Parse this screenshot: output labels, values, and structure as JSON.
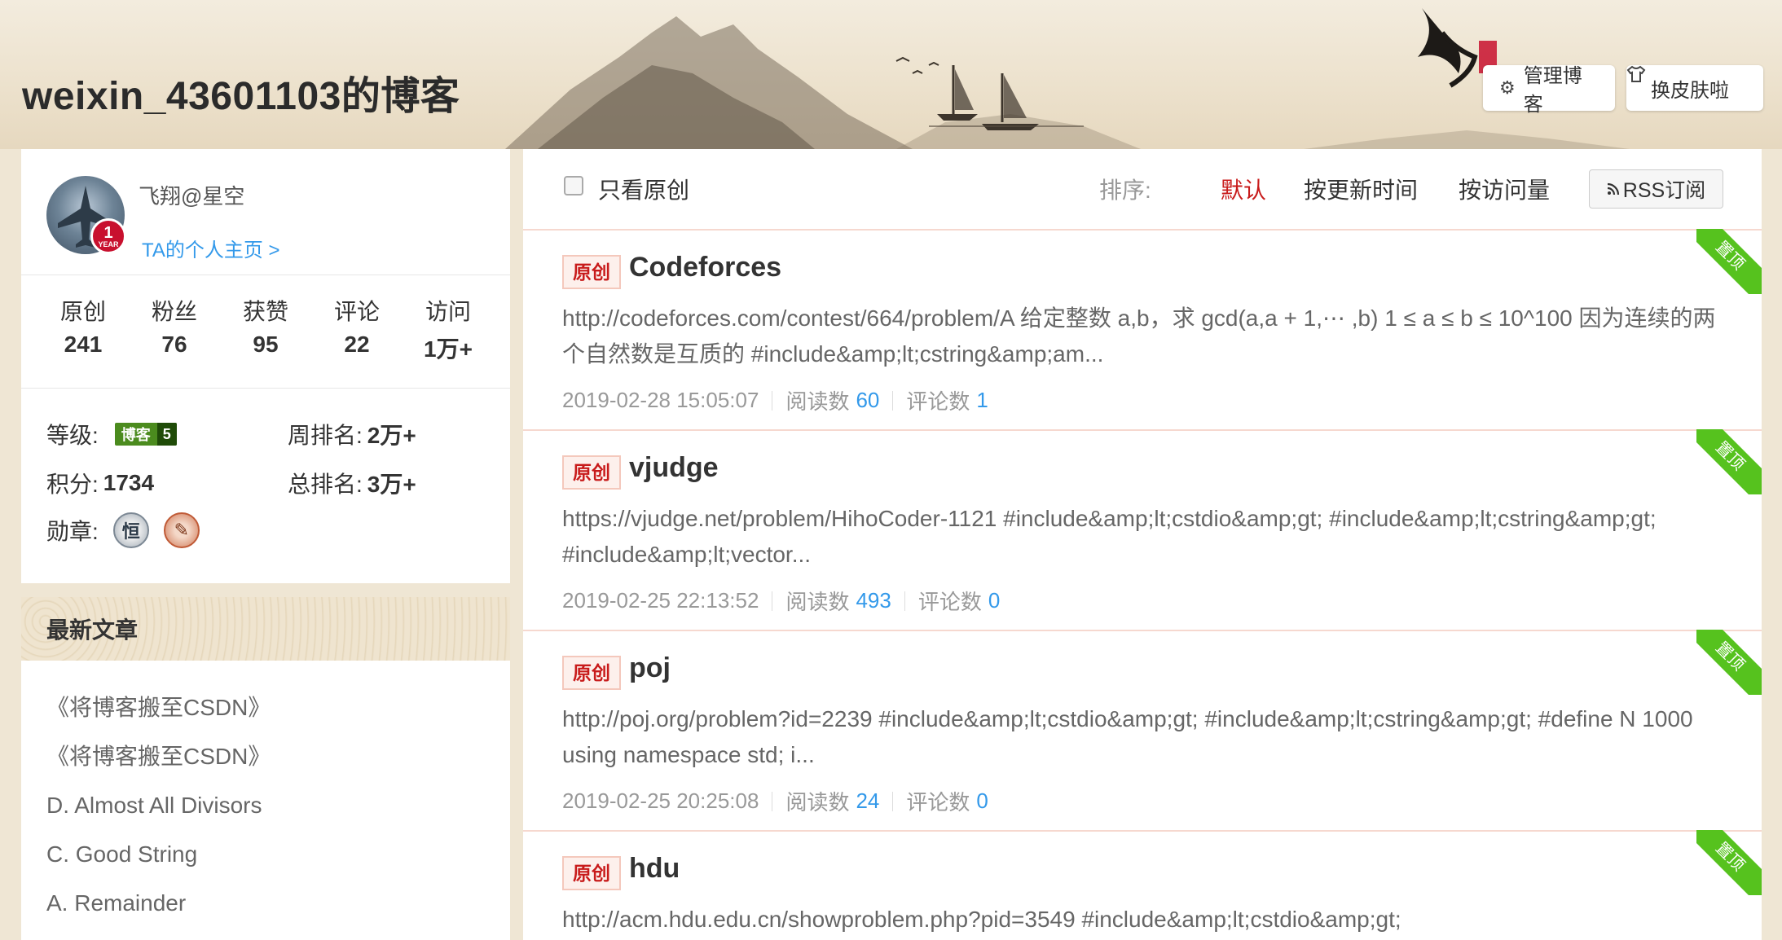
{
  "header": {
    "blog_title": "weixin_43601103的博客",
    "manage_label": "管理博客",
    "skin_label": "换皮肤啦"
  },
  "profile": {
    "name": "飞翔@星空",
    "home_link": "TA的个人主页 >",
    "year_badge": "1",
    "year_text": "YEAR"
  },
  "stats": [
    {
      "label": "原创",
      "value": "241"
    },
    {
      "label": "粉丝",
      "value": "76"
    },
    {
      "label": "获赞",
      "value": "95"
    },
    {
      "label": "评论",
      "value": "22"
    },
    {
      "label": "访问",
      "value": "1万+"
    }
  ],
  "info": {
    "level_label": "等级:",
    "level_badge_text": "博客",
    "level_badge_num": "5",
    "points_label": "积分:",
    "points_value": "1734",
    "medals_label": "勋章:",
    "medal1_text": "恒",
    "week_rank_label": "周排名:",
    "week_rank_value": "2万+",
    "total_rank_label": "总排名:",
    "total_rank_value": "3万+"
  },
  "recent": {
    "heading": "最新文章",
    "items": [
      "《将博客搬至CSDN》",
      "《将博客搬至CSDN》",
      "D. Almost All Divisors",
      "C. Good String",
      "A. Remainder"
    ]
  },
  "filter": {
    "only_original": "只看原创",
    "sort_label": "排序:",
    "sort_default": "默认",
    "sort_update": "按更新时间",
    "sort_visit": "按访问量",
    "rss": "RSS订阅"
  },
  "articles": [
    {
      "tag": "原创",
      "title": "Codeforces",
      "summary": "http://codeforces.com/contest/664/problem/A 给定整数 a,b，求 gcd(a,a + 1,⋯ ,b) 1 ≤ a ≤ b ≤ 10^100 因为连续的两个自然数是互质的 #include&amp;lt;cstring&amp;am...",
      "date": "2019-02-28 15:05:07",
      "read_label": "阅读数",
      "read": "60",
      "comment_label": "评论数",
      "comment": "1",
      "pinned": "置顶"
    },
    {
      "tag": "原创",
      "title": "vjudge",
      "summary": "https://vjudge.net/problem/HihoCoder-1121 #include&amp;lt;cstdio&amp;gt; #include&amp;lt;cstring&amp;gt; #include&amp;lt;vector...",
      "date": "2019-02-25 22:13:52",
      "read_label": "阅读数",
      "read": "493",
      "comment_label": "评论数",
      "comment": "0",
      "pinned": "置顶"
    },
    {
      "tag": "原创",
      "title": "poj",
      "summary": "http://poj.org/problem?id=2239 #include&amp;lt;cstdio&amp;gt; #include&amp;lt;cstring&amp;gt; #define N 1000 using namespace std; i...",
      "date": "2019-02-25 20:25:08",
      "read_label": "阅读数",
      "read": "24",
      "comment_label": "评论数",
      "comment": "0",
      "pinned": "置顶"
    },
    {
      "tag": "原创",
      "title": "hdu",
      "summary": "http://acm.hdu.edu.cn/showproblem.php?pid=3549   #include&amp;lt;cstdio&amp;gt;",
      "pinned": "置顶"
    }
  ],
  "colors": {
    "accent_red": "#c81b1b",
    "link_blue": "#3399ea",
    "pinned_green": "#56c21e",
    "level_green": "#4b8b1e"
  },
  "icons": [
    "gear-icon",
    "tshirt-icon",
    "rss-icon",
    "checkbox"
  ]
}
